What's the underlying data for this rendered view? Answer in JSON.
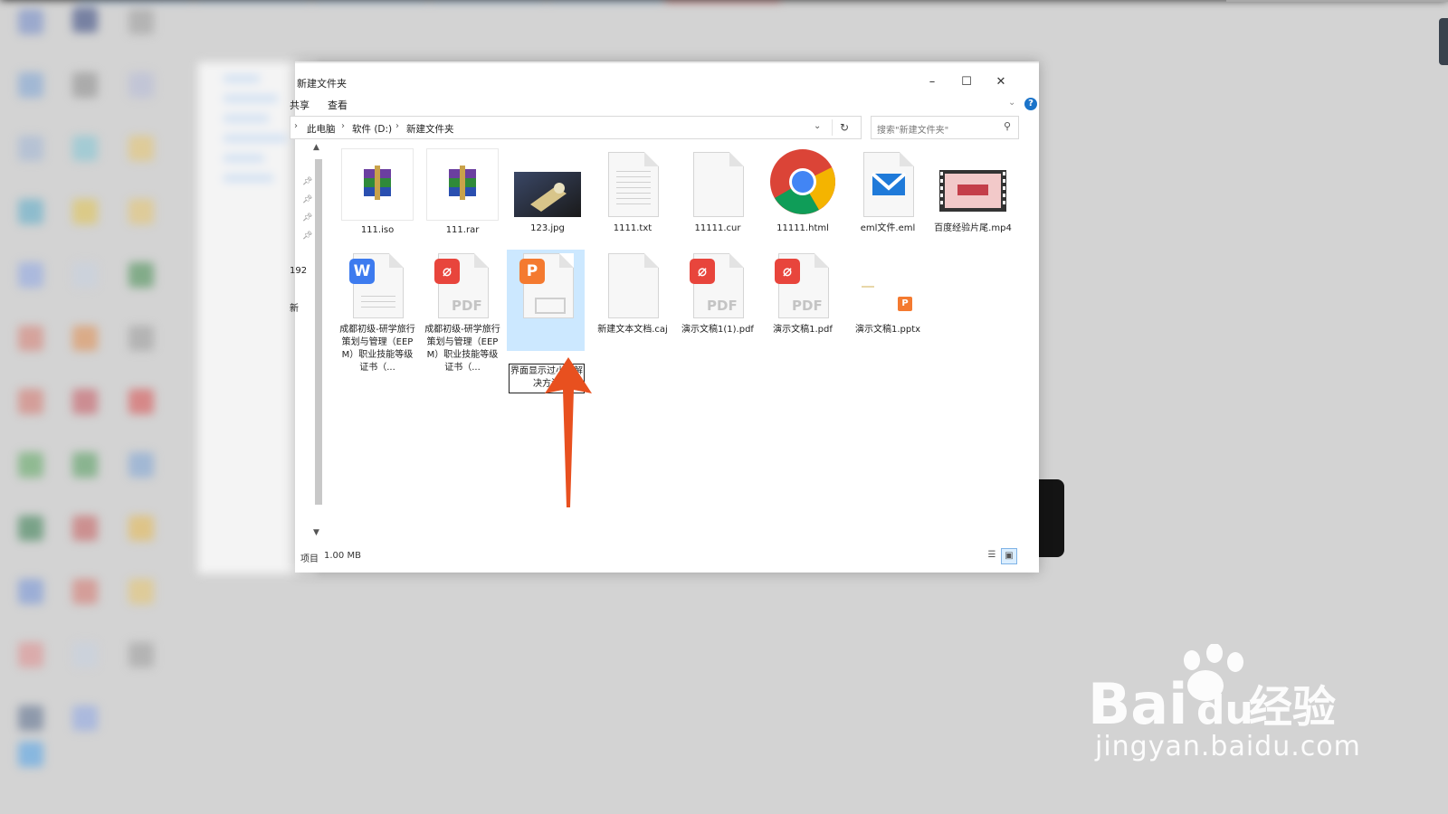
{
  "window": {
    "title": "新建文件夹",
    "minimize": "–",
    "maximize": "☐",
    "close": "✕"
  },
  "ribbon": {
    "tabs": [
      "共享",
      "查看"
    ],
    "help": "?"
  },
  "address": {
    "crumbs": [
      "此电脑",
      "软件 (D:)",
      "新建文件夹"
    ],
    "refresh": "↻"
  },
  "search": {
    "placeholder": "搜索\"新建文件夹\""
  },
  "sidebar": {
    "fragments": [
      "192",
      "新"
    ]
  },
  "files": [
    {
      "name": "111.iso",
      "type": "archive-icon"
    },
    {
      "name": "111.rar",
      "type": "archive-icon"
    },
    {
      "name": "123.jpg",
      "type": "image-thumbnail"
    },
    {
      "name": "1111.txt",
      "type": "text-file-icon"
    },
    {
      "name": "11111.cur",
      "type": "blank-file-icon"
    },
    {
      "name": "11111.html",
      "type": "chrome-icon"
    },
    {
      "name": "eml文件.eml",
      "type": "mail-icon"
    },
    {
      "name": "百度经验片尾.mp4",
      "type": "video-thumbnail"
    },
    {
      "name": "成都初级-研学旅行策划与管理（EEPM）职业技能等级证书（...",
      "type": "word-icon"
    },
    {
      "name": "成都初级-研学旅行策划与管理（EEPM）职业技能等级证书（...",
      "type": "pdf-icon"
    },
    {
      "name": "界面显示过小的解决方法",
      "type": "presentation-icon",
      "renaming": true
    },
    {
      "name": "新建文本文档.caj",
      "type": "blank-file-icon"
    },
    {
      "name": "演示文稿1(1).pdf",
      "type": "pdf-icon"
    },
    {
      "name": "演示文稿1.pdf",
      "type": "pdf-icon"
    },
    {
      "name": "演示文稿1.pptx",
      "type": "pptx-icon"
    }
  ],
  "status": {
    "items_label": "项目",
    "size": "1.00 MB"
  },
  "watermark": {
    "logo": "Bai经验",
    "url": "jingyan.baidu.com"
  },
  "colors": {
    "accent": "#1a73c9",
    "selection": "#cce8ff",
    "arrow": "#e8501f",
    "pdf_red": "#e8453c",
    "ppt_orange": "#f47a30",
    "word_blue": "#3d7bef"
  }
}
